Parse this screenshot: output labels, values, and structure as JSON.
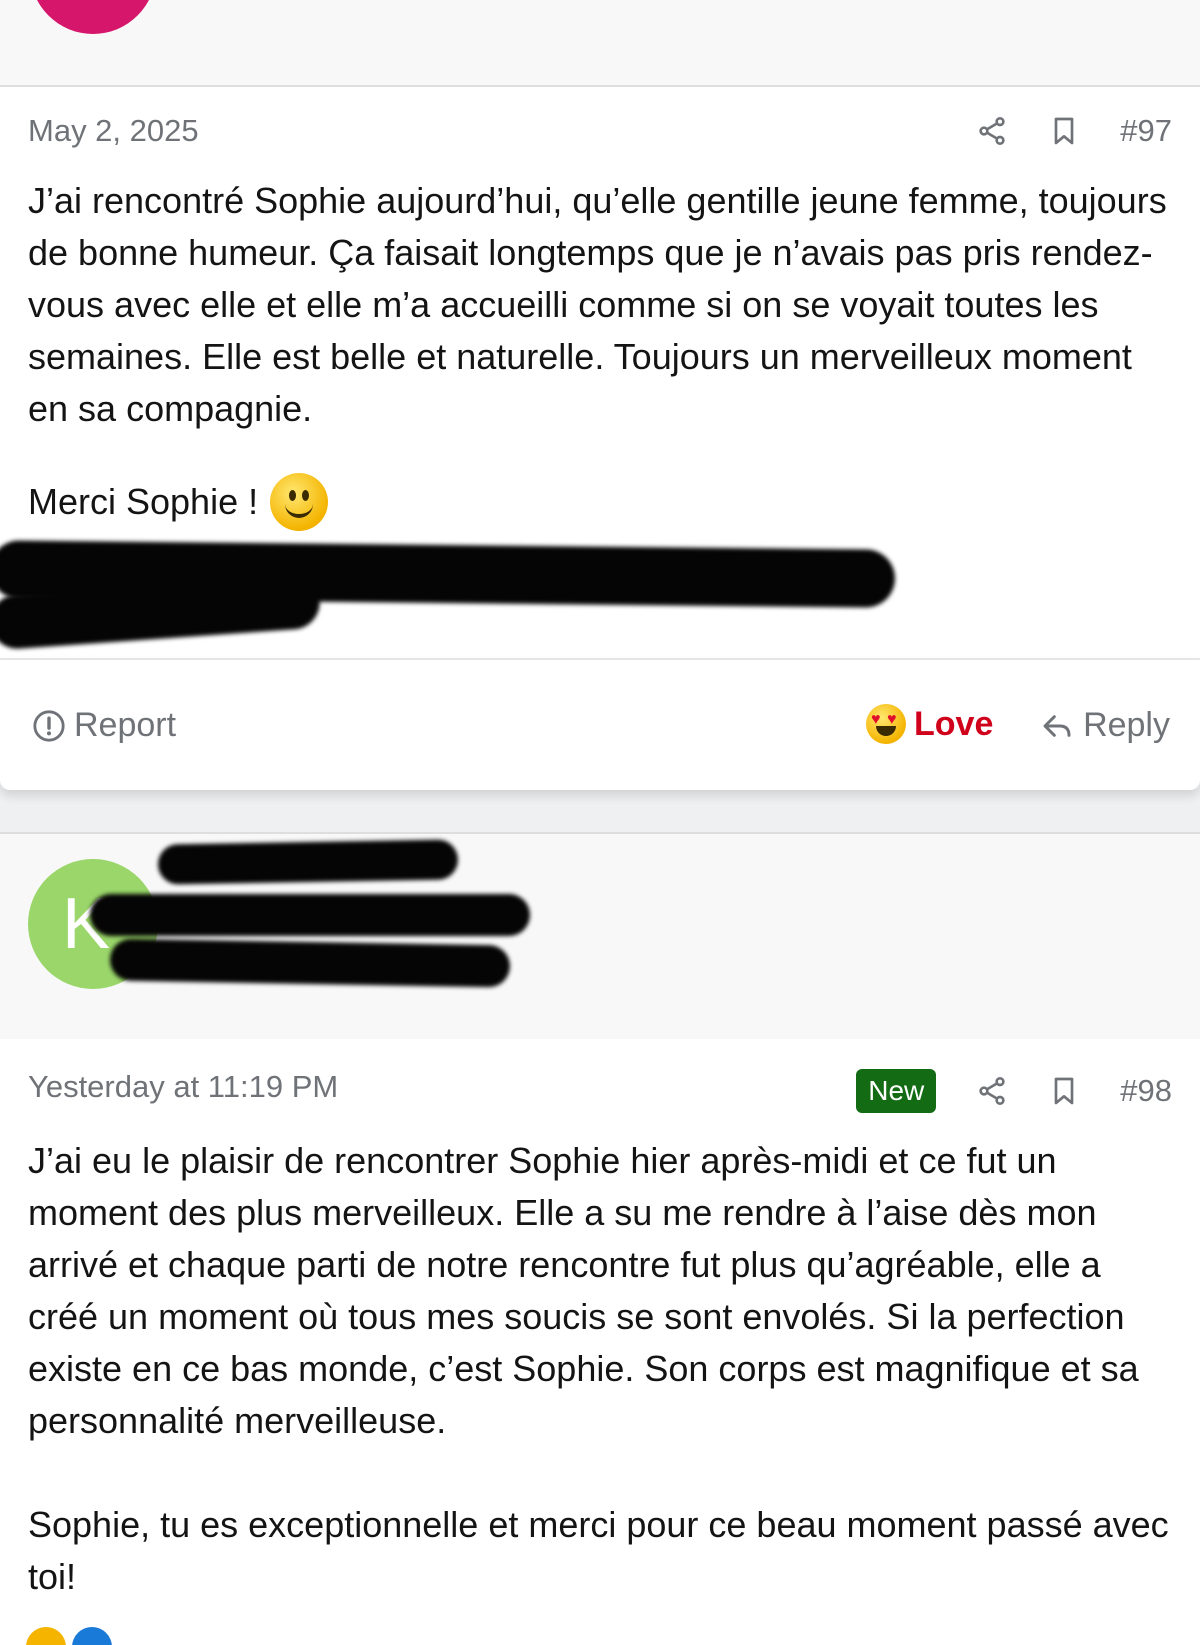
{
  "colors": {
    "accent_love": "#d0021b",
    "badge_new_bg": "#136c13",
    "avatar_top": "#d5166a",
    "avatar_b": "#9ad66a",
    "muted_text": "#6f7378"
  },
  "post97": {
    "date": "May 2, 2025",
    "number": "#97",
    "body": "J’ai rencontré Sophie aujourd’hui, qu’elle gentille jeune femme, toujours de bonne humeur. Ça faisait longtemps que je n’avais pas pris rendez-vous avec elle et elle m’a accueilli comme si on se voyait toutes les semaines. Elle est belle et naturelle. Toujours un merveilleux moment en sa compagnie.",
    "closing": "Merci Sophie !",
    "closing_emoji": "slightly-smiling-face-icon",
    "actions": {
      "report": "Report",
      "love": "Love",
      "reply": "Reply"
    }
  },
  "post98": {
    "author_initial": "K",
    "date": "Yesterday at 11:19 PM",
    "badge": "New",
    "number": "#98",
    "body": "J’ai eu le plaisir de rencontrer Sophie hier après-midi et ce fut un moment des plus merveilleux. Elle a su me rendre à l’aise dès mon arrivé et chaque parti de notre rencontre fut plus qu’agréable, elle a créé un moment où tous mes soucis se sont envolés. Si la perfection existe en ce bas monde, c’est Sophie. Son corps est magnifique et sa personnalité merveilleuse.",
    "closing": "Sophie, tu es exceptionnelle et merci pour ce beau moment passé avec toi!"
  }
}
